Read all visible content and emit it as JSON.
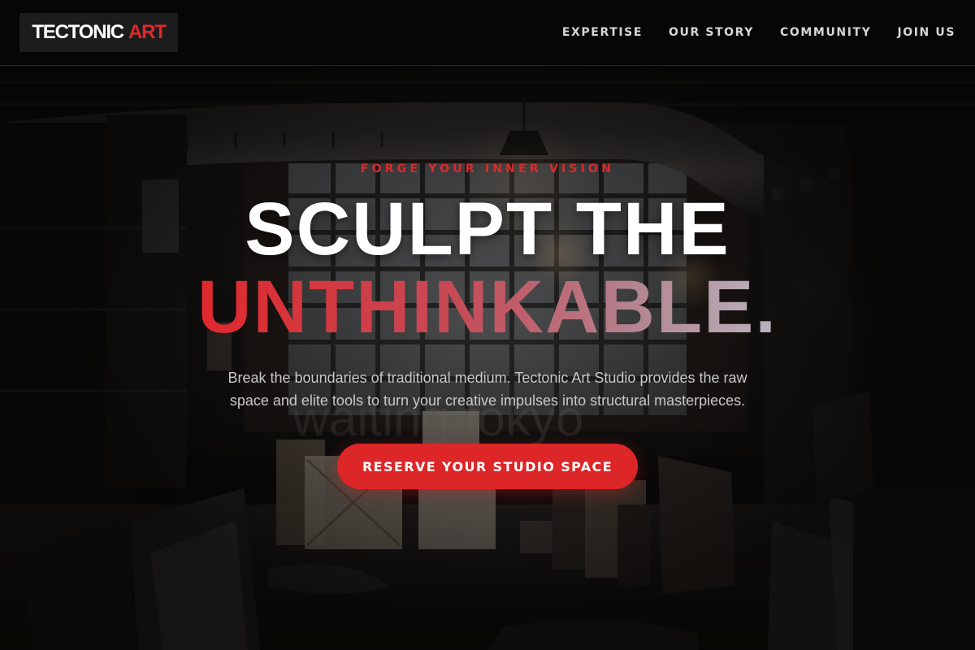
{
  "brand": {
    "name_main": "TECTONIC",
    "name_accent": "ART"
  },
  "nav": {
    "items": [
      {
        "label": "EXPERTISE"
      },
      {
        "label": "OUR STORY"
      },
      {
        "label": "COMMUNITY"
      },
      {
        "label": "JOIN US"
      }
    ]
  },
  "hero": {
    "eyebrow": "FORGE YOUR INNER VISION",
    "headline_line1": "SCULPT THE",
    "headline_line2": "UNTHINKABLE.",
    "subtext": "Break the boundaries of traditional medium. Tectonic Art Studio provides the raw space and elite tools to turn your creative impulses into structural masterpieces.",
    "cta_label": "RESERVE YOUR STUDIO SPACE"
  },
  "colors": {
    "accent": "#dc2628",
    "header_bg": "#060606",
    "logo_bg": "#1c1c1c",
    "nav_text": "#d6d6d6",
    "subtext": "#c8c8c8"
  }
}
